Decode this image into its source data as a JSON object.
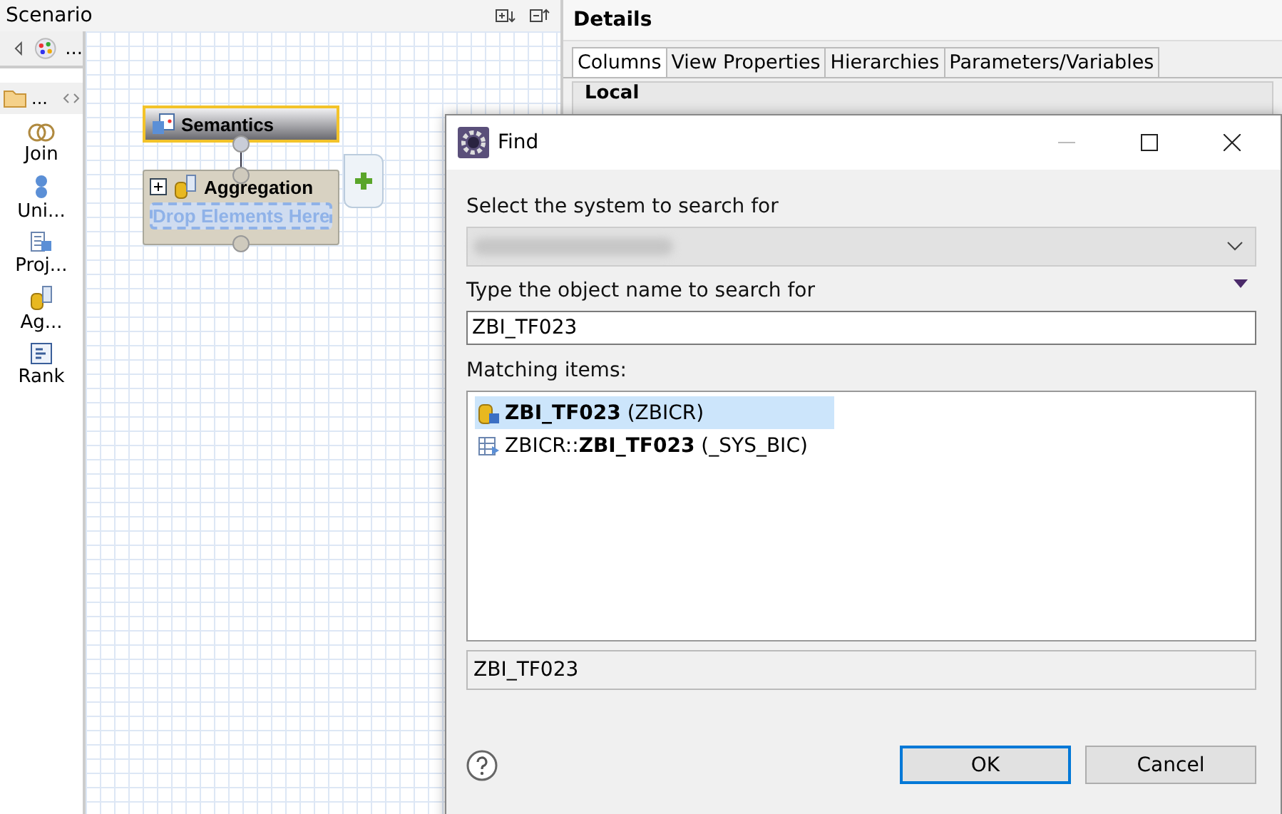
{
  "scenario": {
    "title": "Scenario",
    "toolbar_label": "...",
    "folder_label": "...",
    "palette": [
      {
        "label": "Join",
        "kind": "join"
      },
      {
        "label": "Uni...",
        "kind": "union"
      },
      {
        "label": "Proj...",
        "kind": "projection"
      },
      {
        "label": "Ag...",
        "kind": "aggregation"
      },
      {
        "label": "Rank",
        "kind": "rank"
      }
    ],
    "nodes": [
      {
        "title": "Semantics",
        "kind": "semantics",
        "selected": true
      },
      {
        "title": "Aggregation",
        "kind": "aggregation",
        "selected": false,
        "placeholder": "Drop Elements Here"
      }
    ]
  },
  "details": {
    "title": "Details",
    "section": "Local",
    "tabs": [
      {
        "label": "Columns",
        "selected": true
      },
      {
        "label": "View Properties",
        "selected": false
      },
      {
        "label": "Hierarchies",
        "selected": false
      },
      {
        "label": "Parameters/Variables",
        "selected": false
      }
    ]
  },
  "dialog": {
    "title": "Find",
    "system_label": "Select the system to search for",
    "object_label": "Type the object name to search for",
    "object_value": "ZBI_TF023",
    "matching_label": "Matching items:",
    "items": [
      {
        "text": "**ZBI_TF023** (ZBICR)",
        "kind": "table",
        "selected": true
      },
      {
        "text": "ZBICR::**ZBI_TF023** (_SYS_BIC)",
        "kind": "view",
        "selected": false
      }
    ],
    "status": "ZBI_TF023",
    "buttons": [
      {
        "label": "OK",
        "default": true
      },
      {
        "label": "Cancel",
        "default": false
      }
    ]
  }
}
